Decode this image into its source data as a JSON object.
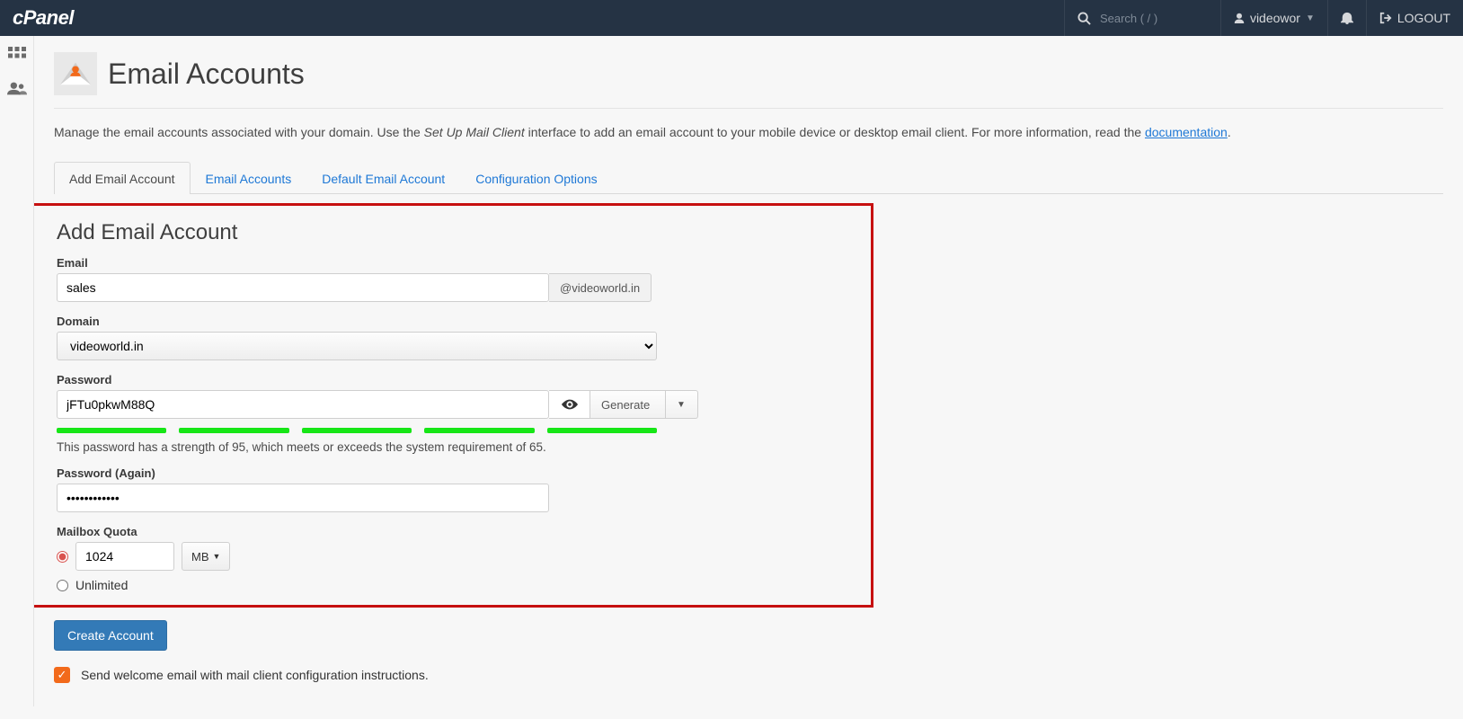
{
  "topnav": {
    "logo": "cPanel",
    "search_placeholder": "Search ( / )",
    "user": "videowor",
    "logout": "LOGOUT"
  },
  "page": {
    "title": "Email Accounts",
    "intro_pre": "Manage the email accounts associated with your domain. Use the ",
    "intro_em": "Set Up Mail Client",
    "intro_post": " interface to add an email account to your mobile device or desktop email client. For more information, read the ",
    "intro_link": "documentation",
    "intro_end": "."
  },
  "tabs": [
    {
      "label": "Add Email Account",
      "active": true
    },
    {
      "label": "Email Accounts"
    },
    {
      "label": "Default Email Account"
    },
    {
      "label": "Configuration Options"
    }
  ],
  "form": {
    "panel_title": "Add Email Account",
    "email_label": "Email",
    "email_value": "sales",
    "email_addon": "@videoworld.in",
    "domain_label": "Domain",
    "domain_value": "videoworld.in",
    "password_label": "Password",
    "password_value": "jFTu0pkwM88Q",
    "generate_label": "Generate",
    "strength_hint": "This password has a strength of 95, which meets or exceeds the system requirement of 65.",
    "password_again_label": "Password (Again)",
    "password_again_value": "••••••••••••",
    "quota_label": "Mailbox Quota",
    "quota_value": "1024",
    "quota_unit": "MB",
    "quota_unlimited": "Unlimited"
  },
  "actions": {
    "create": "Create Account",
    "welcome_text": "Send welcome email with mail client configuration instructions."
  }
}
